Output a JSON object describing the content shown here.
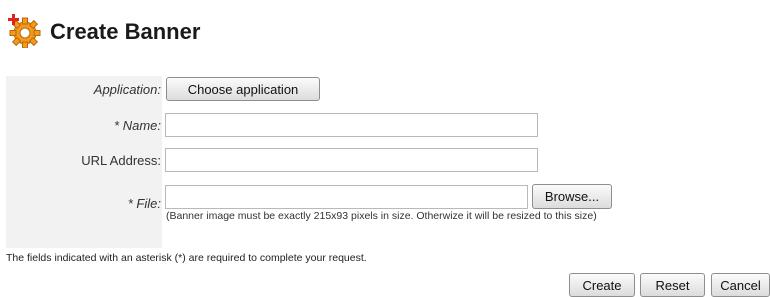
{
  "header": {
    "title": "Create Banner",
    "icon": "gear-plus-icon"
  },
  "form": {
    "application": {
      "label": "Application:",
      "button": "Choose application"
    },
    "name": {
      "label": "* Name:",
      "value": ""
    },
    "url": {
      "label": "URL Address:",
      "value": ""
    },
    "file": {
      "label": "* File:",
      "value": "",
      "browse": "Browse...",
      "hint": "(Banner image must be exactly 215x93 pixels in size. Otherwize it will be resized to this size)"
    }
  },
  "note": "The fields indicated with an asterisk (*) are required to complete your request.",
  "actions": {
    "create": "Create",
    "reset": "Reset",
    "cancel": "Cancel"
  },
  "colors": {
    "icon_orange": "#f39a1e",
    "label_bg": "#f2f2f2"
  }
}
